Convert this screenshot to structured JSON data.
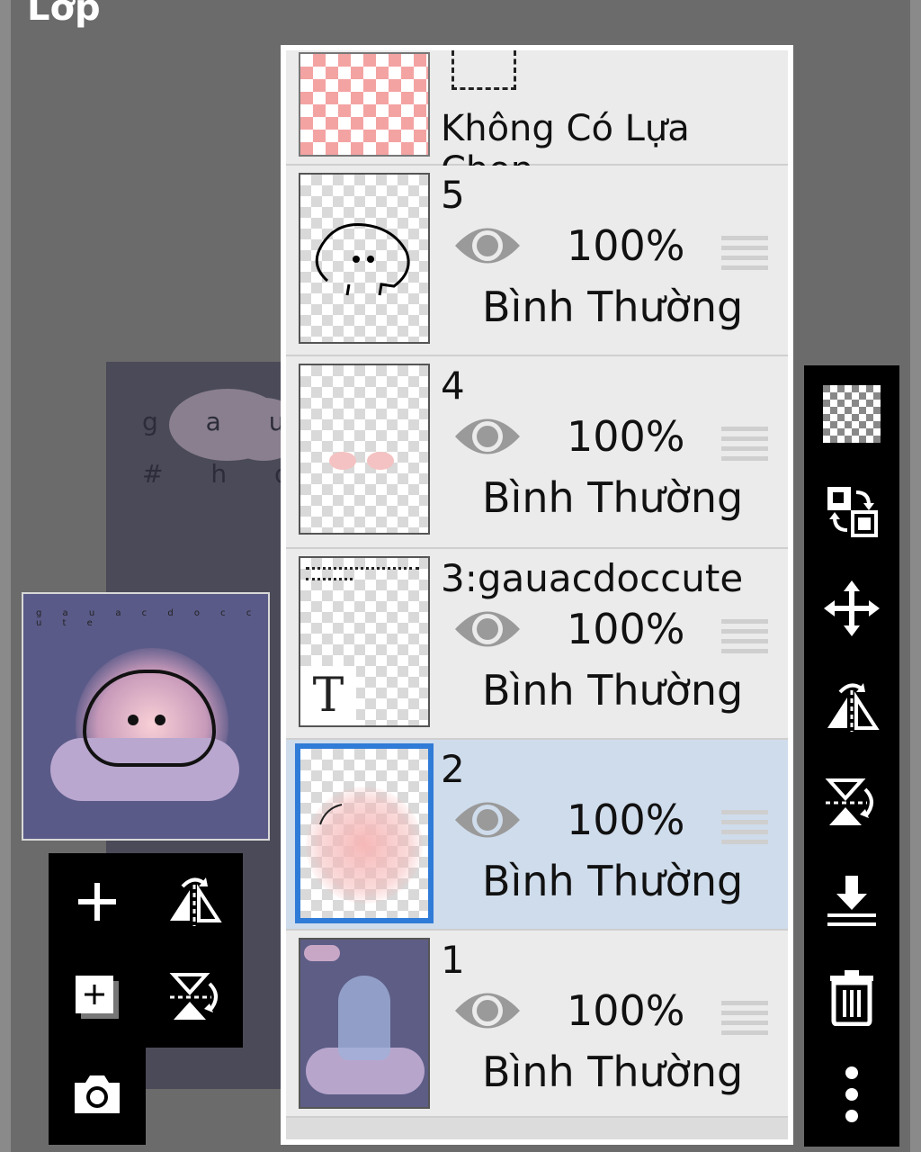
{
  "header": {
    "title": "Lớp"
  },
  "canvas": {
    "text_line1": "g a u",
    "text_line2": "# h d"
  },
  "preview": {
    "tiny_text": "g a u a c d o c c u t e"
  },
  "selection_row": {
    "label": "Không Có Lựa Chọn"
  },
  "layers": [
    {
      "name": "5",
      "opacity": "100%",
      "blend": "Bình Thường",
      "selected": false,
      "thumb": "blob"
    },
    {
      "name": "4",
      "opacity": "100%",
      "blend": "Bình Thường",
      "selected": false,
      "thumb": "cheeks"
    },
    {
      "name": "3:gauacdoccute",
      "opacity": "100%",
      "blend": "Bình Thường",
      "selected": false,
      "thumb": "text",
      "thumb_glyph": "T"
    },
    {
      "name": "2",
      "opacity": "100%",
      "blend": "Bình Thường",
      "selected": true,
      "thumb": "glow"
    },
    {
      "name": "1",
      "opacity": "100%",
      "blend": "Bình Thường",
      "selected": false,
      "thumb": "scene"
    }
  ],
  "left_toolbar": [
    "plus-icon",
    "flip-horizontal-icon",
    "add-layer-icon",
    "flip-vertical-icon",
    "camera-icon"
  ],
  "right_toolbar": [
    "transparency-icon",
    "swap-layers-icon",
    "move-icon",
    "flip-horizontal-icon",
    "flip-vertical-icon",
    "merge-down-icon",
    "trash-icon",
    "more-icon"
  ],
  "colors": {
    "selected_row": "#cfdcec",
    "selected_border": "#2f7bd8",
    "toolbar": "#000000"
  }
}
